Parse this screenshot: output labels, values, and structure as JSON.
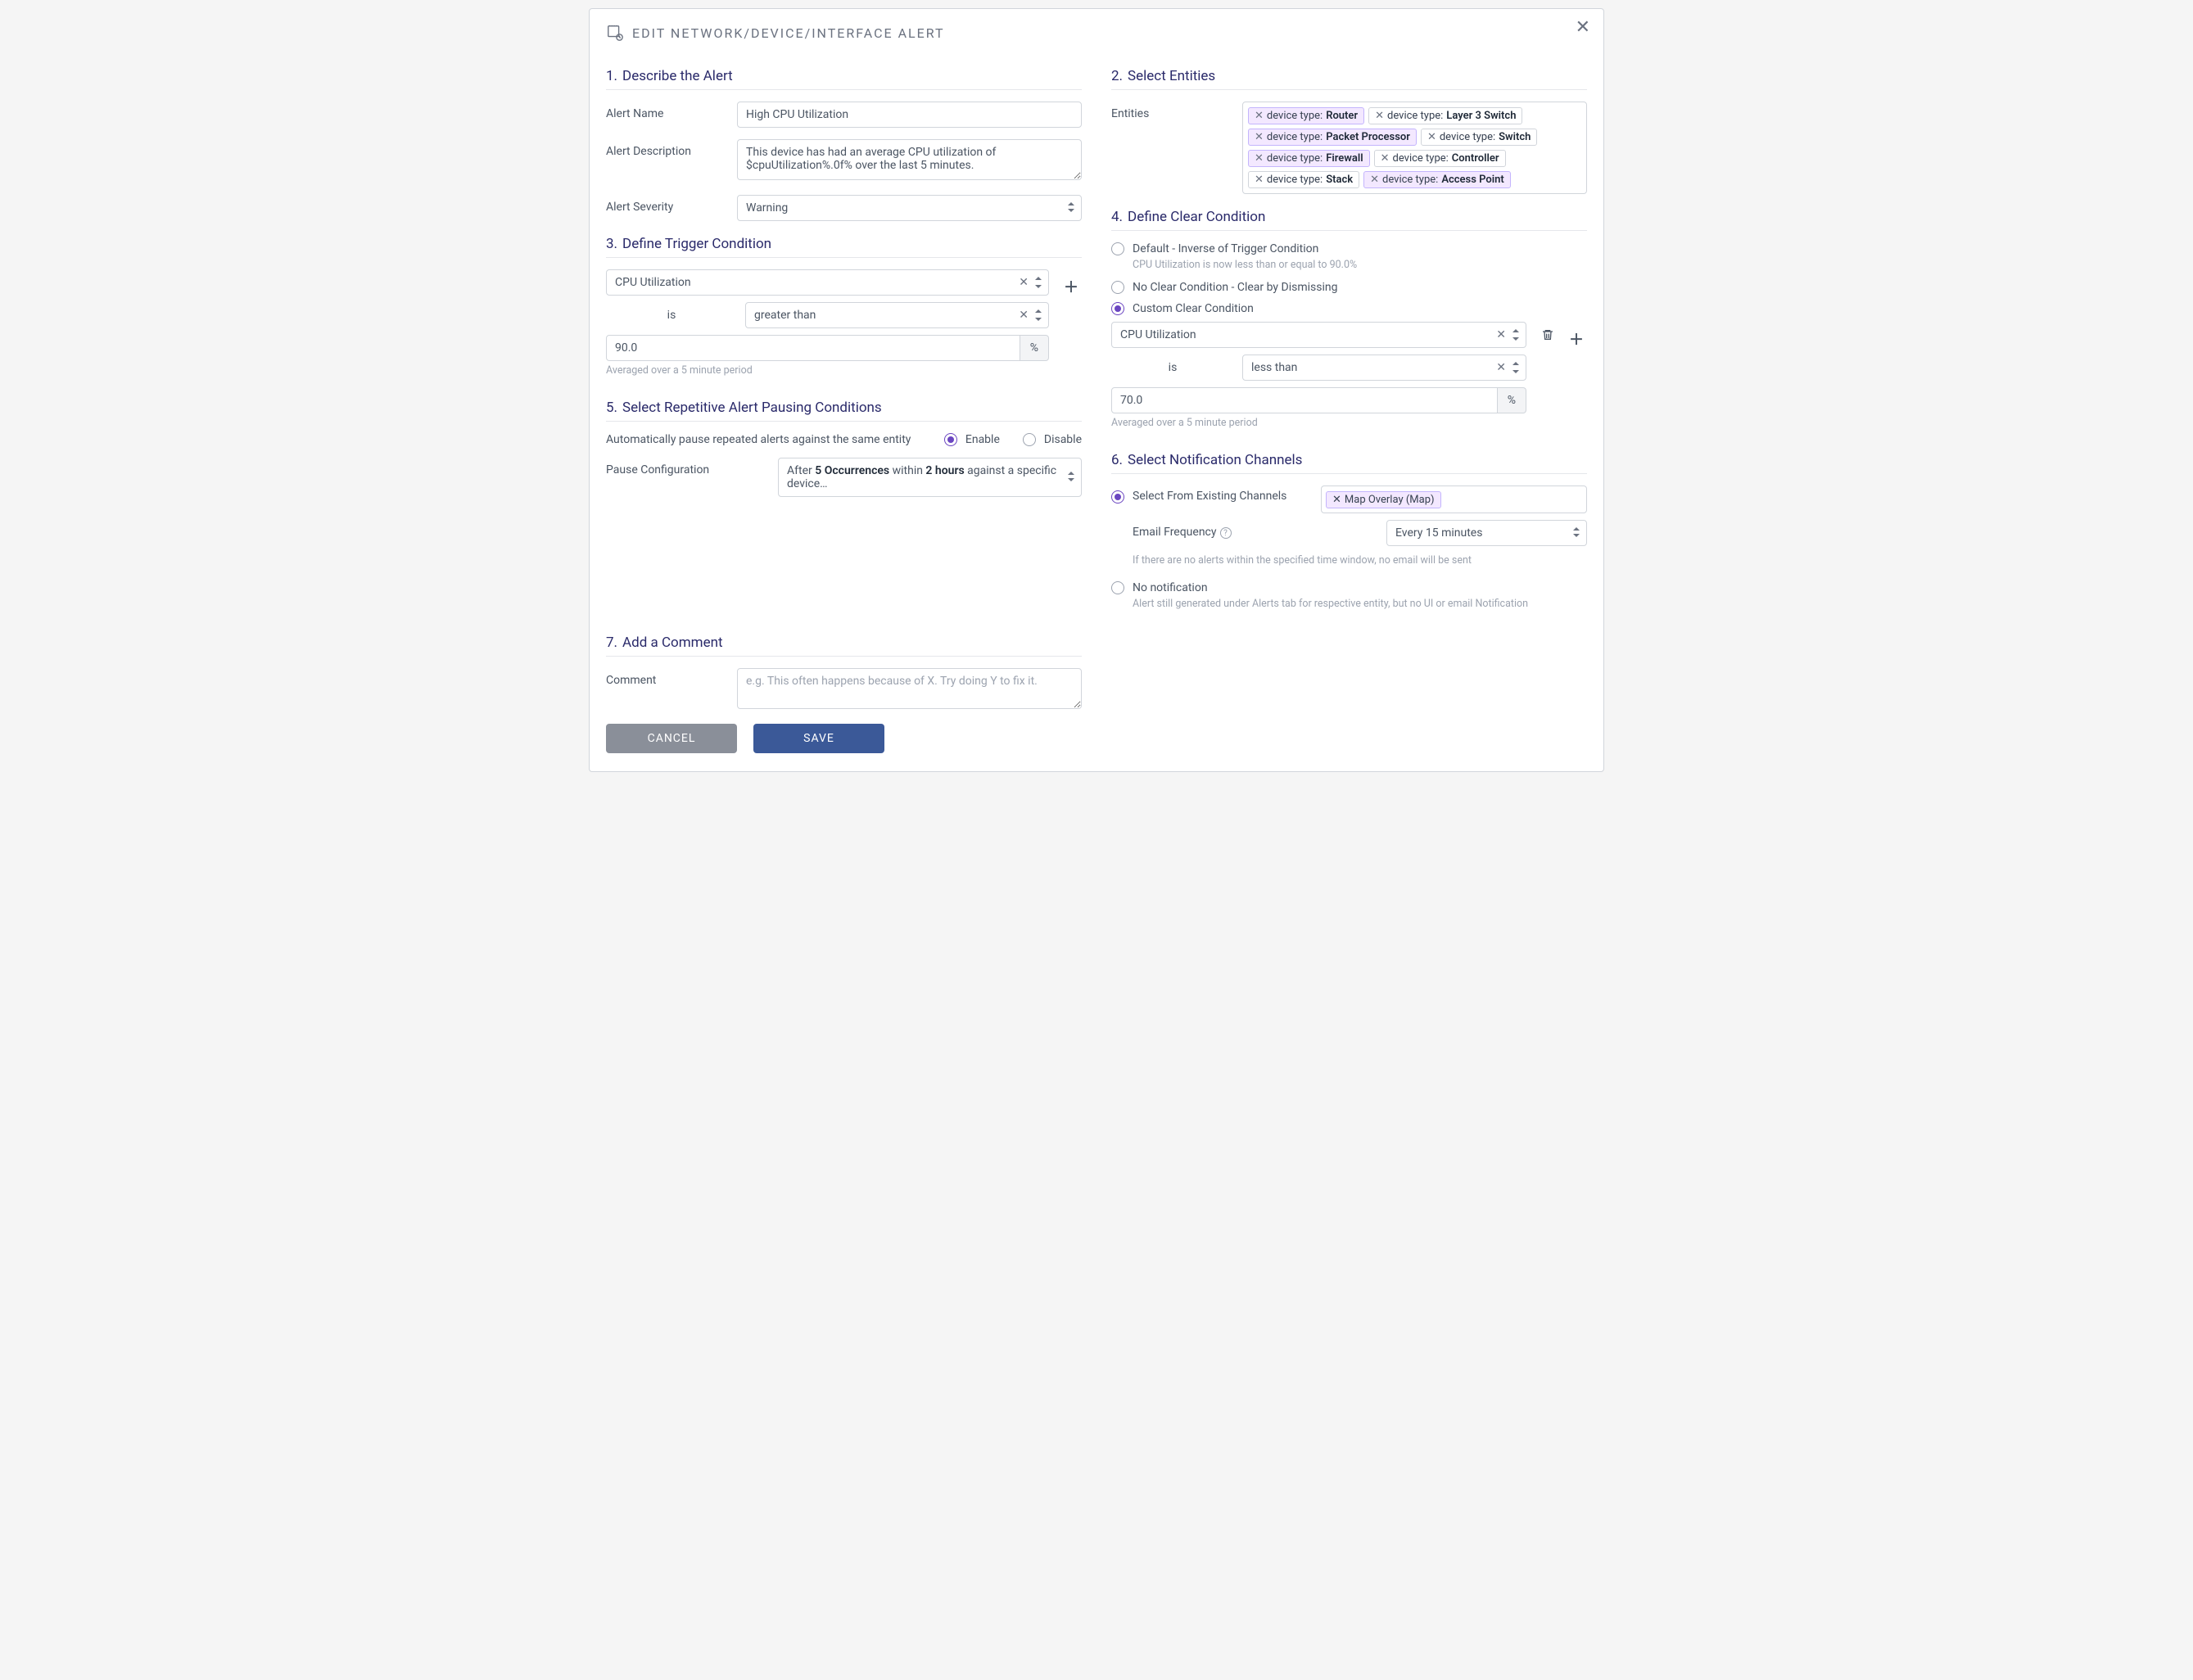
{
  "modal": {
    "title": "EDIT NETWORK/DEVICE/INTERFACE ALERT"
  },
  "s1": {
    "heading": "Describe the Alert",
    "name_label": "Alert Name",
    "name_value": "High CPU Utilization",
    "desc_label": "Alert Description",
    "desc_value": "This device has had an average CPU utilization of $cpuUtilization%.0f% over the last 5 minutes.",
    "severity_label": "Alert Severity",
    "severity_value": "Warning"
  },
  "s2": {
    "heading": "Select Entities",
    "entities_label": "Entities",
    "tag_prefix": "device type:",
    "tags": [
      "Router",
      "Layer 3 Switch",
      "Packet Processor",
      "Switch",
      "Firewall",
      "Controller",
      "Stack",
      "Access Point"
    ]
  },
  "s3": {
    "heading": "Define Trigger Condition",
    "metric": "CPU Utilization",
    "is": "is",
    "operator": "greater than",
    "value": "90.0",
    "unit": "%",
    "hint": "Averaged over a 5 minute period"
  },
  "s4": {
    "heading": "Define Clear Condition",
    "opt_default": "Default - Inverse of Trigger Condition",
    "opt_default_hint": "CPU Utilization is now less than or equal to 90.0%",
    "opt_none": "No Clear Condition - Clear by Dismissing",
    "opt_custom": "Custom Clear Condition",
    "metric": "CPU Utilization",
    "is": "is",
    "operator": "less than",
    "value": "70.0",
    "unit": "%",
    "hint": "Averaged over a 5 minute period"
  },
  "s5": {
    "heading": "Select Repetitive Alert Pausing Conditions",
    "auto_label": "Automatically pause repeated alerts against the same entity",
    "enable": "Enable",
    "disable": "Disable",
    "pause_label": "Pause Configuration",
    "pause_pre": "After ",
    "pause_b1": "5 Occurrences",
    "pause_mid": " within ",
    "pause_b2": "2 hours",
    "pause_post": " against a specific device…"
  },
  "s6": {
    "heading": "Select Notification Channels",
    "opt_existing": "Select From Existing Channels",
    "channel": "Map Overlay (Map)",
    "freq_label": "Email Frequency",
    "freq_value": "Every 15 minutes",
    "freq_hint": "If there are no alerts within the specified time window, no email will be sent",
    "opt_none": "No notification",
    "opt_none_hint": "Alert still generated under Alerts tab for respective entity, but no UI or email Notification"
  },
  "s7": {
    "heading": "Add a Comment",
    "label": "Comment",
    "placeholder": "e.g. This often happens because of X. Try doing Y to fix it."
  },
  "buttons": {
    "cancel": "CANCEL",
    "save": "SAVE"
  }
}
